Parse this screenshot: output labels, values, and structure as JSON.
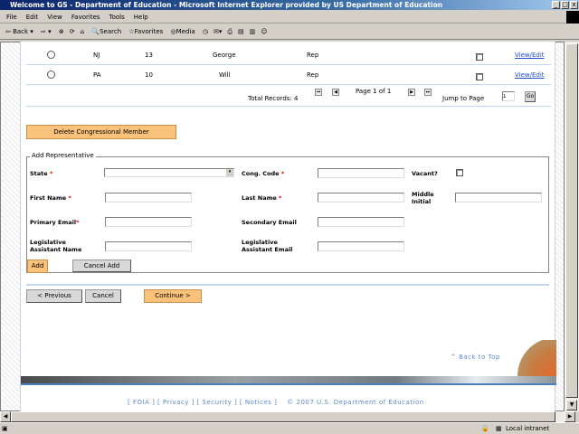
{
  "window": {
    "title": "Welcome to GS - Department of Education - Microsoft Internet Explorer provided by US Department of Education"
  },
  "menu": [
    "File",
    "Edit",
    "View",
    "Favorites",
    "Tools",
    "Help"
  ],
  "toolbar": {
    "back": "Back",
    "search": "Search",
    "favorites": "Favorites",
    "media": "Media"
  },
  "table": {
    "rows": [
      {
        "state": "NJ",
        "code": "13",
        "name": "George",
        "party": "Rep",
        "link": "View/Edit"
      },
      {
        "state": "PA",
        "code": "10",
        "name": "Will",
        "party": "Rep",
        "link": "View/Edit"
      }
    ],
    "total_records": "Total Records: 4",
    "page_info": "Page 1 of 1",
    "jump_label": "Jump to Page",
    "jump_value": "1",
    "go": "Go"
  },
  "delete_button": "Delete Congressional Member",
  "form": {
    "legend": "Add Representative",
    "state": "State",
    "cong_code": "Cong. Code",
    "vacant": "Vacant?",
    "first_name": "First Name",
    "last_name": "Last Name",
    "middle_initial": "Middle Initial",
    "primary_email": "Primary Email",
    "secondary_email": "Secondary Email",
    "la_name": "Legislative Assistant Name",
    "la_email": "Legislative Assistant Email",
    "required": "*",
    "add": "Add",
    "cancel_add": "Cancel Add"
  },
  "nav": {
    "previous": "< Previous",
    "cancel": "Cancel",
    "continue": "Continue >"
  },
  "back_to_top": "^ Back to Top",
  "footer": {
    "links": [
      "FOIA",
      "Privacy",
      "Security",
      "Notices"
    ],
    "copyright": "© 2007 U.S. Department of Education"
  },
  "status": {
    "zone": "Local intranet"
  }
}
